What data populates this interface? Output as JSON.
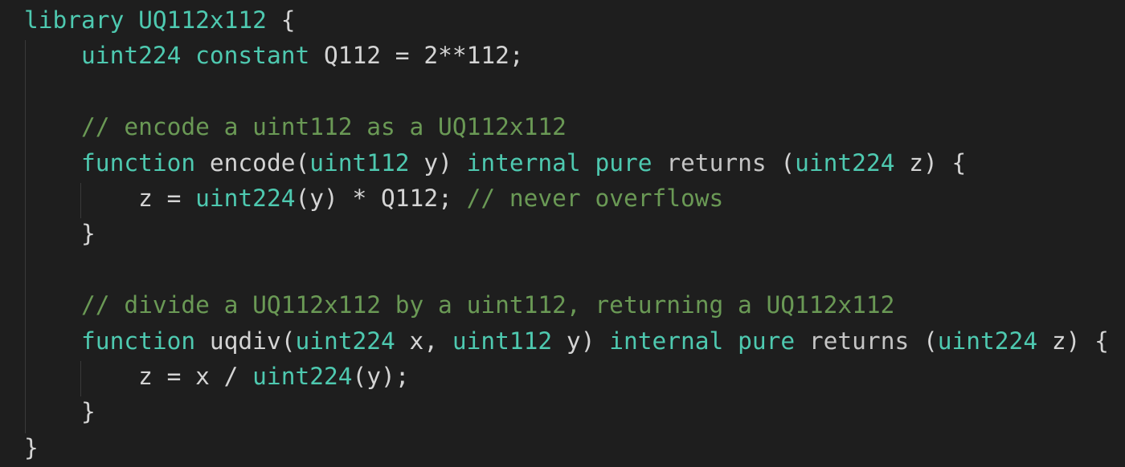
{
  "editor": {
    "language": "solidity",
    "background_color": "#1e1e1e",
    "colors": {
      "type": "#4ec9b0",
      "comment": "#6a9955",
      "text": "#d4d4d4"
    },
    "lines": [
      {
        "tokens": [
          {
            "t": "library ",
            "c": "type"
          },
          {
            "t": "UQ112x112",
            "c": "type"
          },
          {
            "t": " {",
            "c": "punc"
          }
        ]
      },
      {
        "tokens": [
          {
            "t": "    ",
            "c": "punc"
          },
          {
            "t": "uint224",
            "c": "type"
          },
          {
            "t": " ",
            "c": "punc"
          },
          {
            "t": "constant",
            "c": "type"
          },
          {
            "t": " Q112 = 2**112;",
            "c": "id"
          }
        ]
      },
      {
        "tokens": []
      },
      {
        "tokens": [
          {
            "t": "    ",
            "c": "punc"
          },
          {
            "t": "// encode a uint112 as a UQ112x112",
            "c": "cmt"
          }
        ]
      },
      {
        "tokens": [
          {
            "t": "    ",
            "c": "punc"
          },
          {
            "t": "function",
            "c": "type"
          },
          {
            "t": " encode(",
            "c": "id"
          },
          {
            "t": "uint112",
            "c": "type"
          },
          {
            "t": " y) ",
            "c": "id"
          },
          {
            "t": "internal",
            "c": "type"
          },
          {
            "t": " ",
            "c": "punc"
          },
          {
            "t": "pure",
            "c": "type"
          },
          {
            "t": " ",
            "c": "punc"
          },
          {
            "t": "returns",
            "c": "ret"
          },
          {
            "t": " (",
            "c": "punc"
          },
          {
            "t": "uint224",
            "c": "type"
          },
          {
            "t": " z) {",
            "c": "id"
          }
        ]
      },
      {
        "tokens": [
          {
            "t": "        z = ",
            "c": "id"
          },
          {
            "t": "uint224",
            "c": "type"
          },
          {
            "t": "(y) * Q112; ",
            "c": "id"
          },
          {
            "t": "// never overflows",
            "c": "cmt"
          }
        ]
      },
      {
        "tokens": [
          {
            "t": "    }",
            "c": "punc"
          }
        ]
      },
      {
        "tokens": []
      },
      {
        "tokens": [
          {
            "t": "    ",
            "c": "punc"
          },
          {
            "t": "// divide a UQ112x112 by a uint112, returning a UQ112x112",
            "c": "cmt"
          }
        ]
      },
      {
        "tokens": [
          {
            "t": "    ",
            "c": "punc"
          },
          {
            "t": "function",
            "c": "type"
          },
          {
            "t": " uqdiv(",
            "c": "id"
          },
          {
            "t": "uint224",
            "c": "type"
          },
          {
            "t": " x, ",
            "c": "id"
          },
          {
            "t": "uint112",
            "c": "type"
          },
          {
            "t": " y) ",
            "c": "id"
          },
          {
            "t": "internal",
            "c": "type"
          },
          {
            "t": " ",
            "c": "punc"
          },
          {
            "t": "pure",
            "c": "type"
          },
          {
            "t": " ",
            "c": "punc"
          },
          {
            "t": "returns",
            "c": "ret"
          },
          {
            "t": " (",
            "c": "punc"
          },
          {
            "t": "uint224",
            "c": "type"
          },
          {
            "t": " z) {",
            "c": "id"
          }
        ]
      },
      {
        "tokens": [
          {
            "t": "        z = x / ",
            "c": "id"
          },
          {
            "t": "uint224",
            "c": "type"
          },
          {
            "t": "(y);",
            "c": "id"
          }
        ]
      },
      {
        "tokens": [
          {
            "t": "    }",
            "c": "punc"
          }
        ]
      },
      {
        "tokens": [
          {
            "t": "}",
            "c": "punc"
          }
        ]
      }
    ]
  }
}
